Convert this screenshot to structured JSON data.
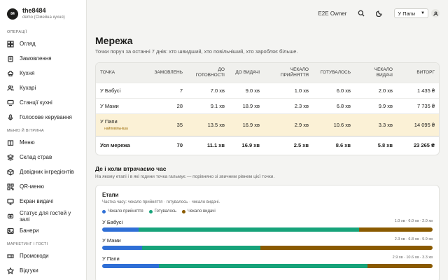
{
  "brand": {
    "avatar": "84",
    "name": "the8484",
    "sub": "demo (Сімейна кухня)"
  },
  "sidebar": {
    "sections": [
      {
        "title": "ОПЕРАЦІЇ",
        "items": [
          {
            "label": "Огляд",
            "icon": "grid-icon"
          },
          {
            "label": "Замовлення",
            "icon": "clipboard-icon"
          },
          {
            "label": "Кухня",
            "icon": "chef-hat-icon"
          },
          {
            "label": "Кухарі",
            "icon": "users-icon"
          },
          {
            "label": "Станції кухні",
            "icon": "station-icon"
          },
          {
            "label": "Голосове керування",
            "icon": "mic-icon"
          }
        ]
      },
      {
        "title": "МЕНЮ Й ВІТРИНА",
        "items": [
          {
            "label": "Меню",
            "icon": "book-icon"
          },
          {
            "label": "Склад страв",
            "icon": "layers-icon"
          },
          {
            "label": "Довідник інгредієнтів",
            "icon": "box-icon"
          },
          {
            "label": "QR-меню",
            "icon": "qr-icon"
          },
          {
            "label": "Екран видачі",
            "icon": "monitor-icon"
          },
          {
            "label": "Статус для гостей у залі",
            "icon": "status-icon"
          },
          {
            "label": "Банери",
            "icon": "image-icon"
          }
        ]
      },
      {
        "title": "МАРКЕТИНГ І ГОСТІ",
        "items": [
          {
            "label": "Промокоди",
            "icon": "ticket-icon"
          },
          {
            "label": "Відгуки",
            "icon": "star-icon"
          }
        ]
      }
    ]
  },
  "topbar": {
    "role": "E2E Owner",
    "location_select": "У Папи"
  },
  "page": {
    "title": "Мережа",
    "subtitle": "Точки поруч за останні 7 днів: хто швидший, хто повільніший, хто заробляє більше."
  },
  "table": {
    "columns": [
      "ТОЧКА",
      "ЗАМОВЛЕНЬ",
      "ДО ГОТОВНОСТІ",
      "ДО ВИДАЧІ",
      "ЧЕКАЛО ПРИЙНЯТТЯ",
      "ГОТУВАЛОСЬ",
      "ЧЕКАЛО ВИДАЧІ",
      "ВИТОРГ"
    ],
    "rows": [
      {
        "name": "У Бабусі",
        "badge": "",
        "orders": "7",
        "to_ready": "7.0 хв",
        "to_pickup": "9.0 хв",
        "wait_accept": "1.0 хв",
        "cooking": "6.0 хв",
        "wait_pickup": "2.0 хв",
        "revenue": "1 435 ₴"
      },
      {
        "name": "У Мами",
        "badge": "",
        "orders": "28",
        "to_ready": "9.1 хв",
        "to_pickup": "18.9 хв",
        "wait_accept": "2.3 хв",
        "cooking": "6.8 хв",
        "wait_pickup": "9.9 хв",
        "revenue": "7 735 ₴"
      },
      {
        "name": "У Папи",
        "badge": "найповільніша",
        "orders": "35",
        "to_ready": "13.5 хв",
        "to_pickup": "16.9 хв",
        "wait_accept": "2.9 хв",
        "cooking": "10.6 хв",
        "wait_pickup": "3.3 хв",
        "revenue": "14 095 ₴"
      }
    ],
    "total": {
      "name": "Уся мережа",
      "orders": "70",
      "to_ready": "11.1 хв",
      "to_pickup": "16.9 хв",
      "wait_accept": "2.5 хв",
      "cooking": "8.6 хв",
      "wait_pickup": "5.8 хв",
      "revenue": "23 265 ₴"
    }
  },
  "time_section": {
    "title": "Де і коли втрачаємо час",
    "subtitle": "На якому етапі і в які години точка гальмує — порівняно зі звичним рівнем цієї точки."
  },
  "stages": {
    "title": "Етапи",
    "subtitle": "Частка часу: чекало прийняття · готувалось · чекало видачі.",
    "legend": [
      {
        "label": "Чекало прийняття",
        "color": "#2f6fd6"
      },
      {
        "label": "Готувалось",
        "color": "#17a37a"
      },
      {
        "label": "Чекало видачі",
        "color": "#8a5a00"
      }
    ],
    "rows": [
      {
        "name": "У Бабусі",
        "nums": "1.0 хв · 6.0 хв · 2.0 хв",
        "values": [
          1.0,
          6.0,
          2.0
        ]
      },
      {
        "name": "У Мами",
        "nums": "2.3 хв · 6.8 хв · 9.9 хв",
        "values": [
          2.3,
          6.8,
          9.9
        ]
      },
      {
        "name": "У Папи",
        "nums": "2.9 хв · 10.6 хв · 3.3 хв",
        "values": [
          2.9,
          10.6,
          3.3
        ]
      }
    ]
  }
}
